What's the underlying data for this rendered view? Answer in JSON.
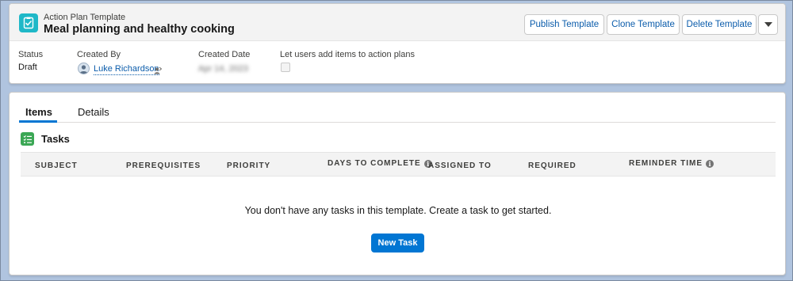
{
  "header": {
    "object_label": "Action Plan Template",
    "title": "Meal planning and healthy cooking",
    "icon": "checklist-icon",
    "buttons": {
      "publish": "Publish Template",
      "clone": "Clone Template",
      "delete": "Delete Template",
      "menu_icon": "chevron-down-icon"
    }
  },
  "fields": {
    "status": {
      "label": "Status",
      "value": "Draft"
    },
    "created_by": {
      "label": "Created By",
      "value": "Luke Richardson"
    },
    "created_date": {
      "label": "Created Date",
      "value": "Apr 14, 2023"
    },
    "allow_add": {
      "label": "Let users add items to action plans",
      "checked": false
    }
  },
  "tabs": [
    {
      "label": "Items",
      "active": true
    },
    {
      "label": "Details",
      "active": false
    }
  ],
  "tasks": {
    "title": "Tasks",
    "columns": [
      "SUBJECT",
      "PREREQUISITES",
      "PRIORITY",
      "DAYS TO COMPLETE",
      "ASSIGNED TO",
      "REQUIRED",
      "REMINDER TIME"
    ],
    "empty_message": "You don't have any tasks in this template. Create a task to get started.",
    "new_task_button": "New Task"
  },
  "colors": {
    "accent": "#0176d3",
    "record_icon": "#1fb8c8",
    "tasks_icon": "#3ba755",
    "backdrop": "#b0c4df"
  }
}
